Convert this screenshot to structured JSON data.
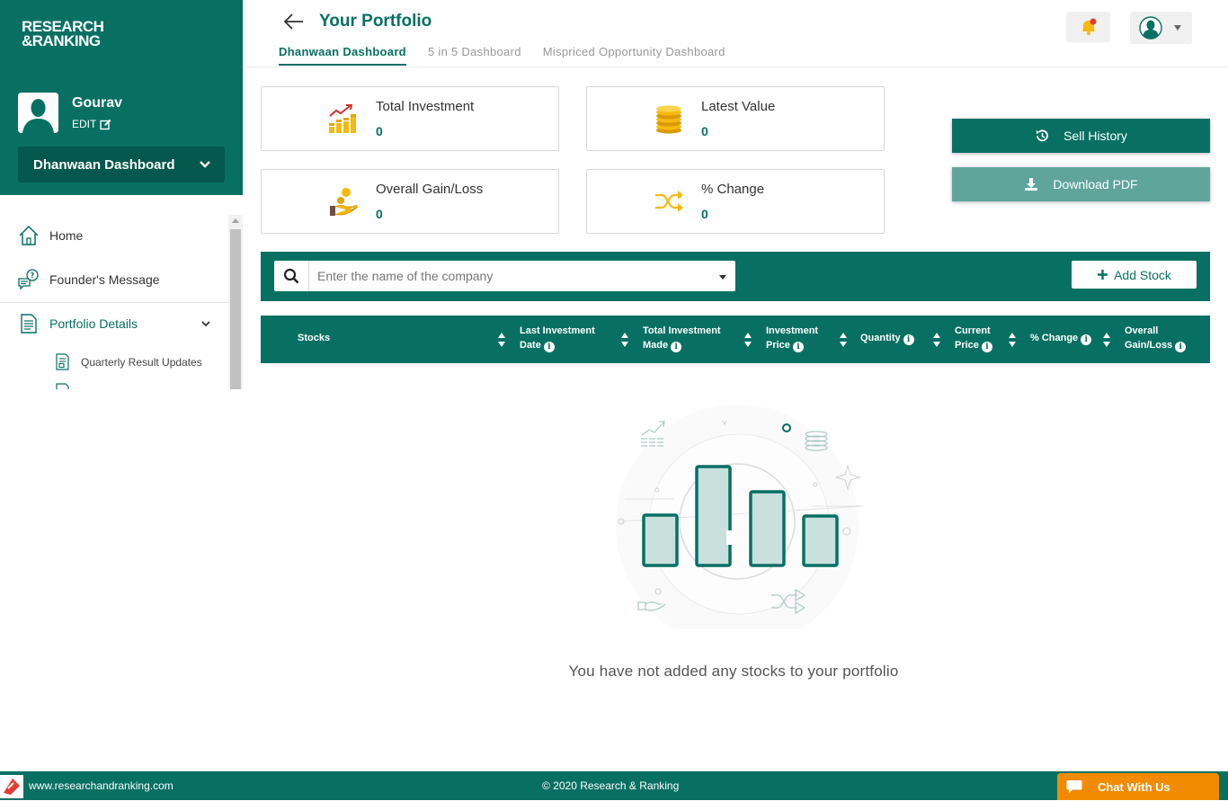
{
  "brand": {
    "logo_line1": "RESEARCH",
    "logo_line2": "&RANKING",
    "primary_color": "#077063",
    "accent_color": "#f28b00"
  },
  "user": {
    "name": "Gourav",
    "edit_label": "EDIT"
  },
  "sidebar": {
    "dashboard_select": "Dhanwaan Dashboard",
    "items": [
      {
        "label": "Home",
        "icon": "home-icon"
      },
      {
        "label": "Founder's Message",
        "icon": "message-icon"
      },
      {
        "label": "Portfolio Details",
        "icon": "document-icon"
      }
    ],
    "sub_items": [
      {
        "label": "Quarterly Result Updates",
        "icon": "report-icon"
      }
    ]
  },
  "header": {
    "title": "Your Portfolio",
    "tabs": [
      {
        "label": "Dhanwaan Dashboard",
        "active": true
      },
      {
        "label": "5 in 5 Dashboard",
        "active": false
      },
      {
        "label": "Mispriced Opportunity Dashboard",
        "active": false
      }
    ]
  },
  "cards": [
    {
      "label": "Total Investment",
      "value": "0",
      "icon": "growth-chart-icon"
    },
    {
      "label": "Latest Value",
      "value": "0",
      "icon": "coins-stack-icon"
    },
    {
      "label": "Overall Gain/Loss",
      "value": "0",
      "icon": "hand-coin-icon"
    },
    {
      "label": "% Change",
      "value": "0",
      "icon": "shuffle-arrows-icon"
    }
  ],
  "actions": {
    "sell_history": "Sell History",
    "download_pdf": "Download PDF"
  },
  "search": {
    "placeholder": "Enter the name of the company",
    "add_stock": "Add Stock"
  },
  "table": {
    "columns": [
      {
        "line1": "Stocks",
        "line2": "",
        "info": false
      },
      {
        "line1": "Last Investment",
        "line2": "Date",
        "info": true
      },
      {
        "line1": "Total Investment",
        "line2": "Made",
        "info": true
      },
      {
        "line1": "Investment",
        "line2": "Price",
        "info": true
      },
      {
        "line1": "Quantity",
        "line2": "",
        "info": true
      },
      {
        "line1": "Current",
        "line2": "Price",
        "info": true
      },
      {
        "line1": "% Change",
        "line2": "",
        "info": true
      },
      {
        "line1": "Overall",
        "line2": "Gain/Loss",
        "info": true
      }
    ]
  },
  "empty_state": {
    "message": "You have not added any stocks to your portfolio"
  },
  "footer": {
    "site": "www.researchandranking.com",
    "copyright": "© 2020 Research & Ranking",
    "chat_label": "Chat With Us"
  }
}
